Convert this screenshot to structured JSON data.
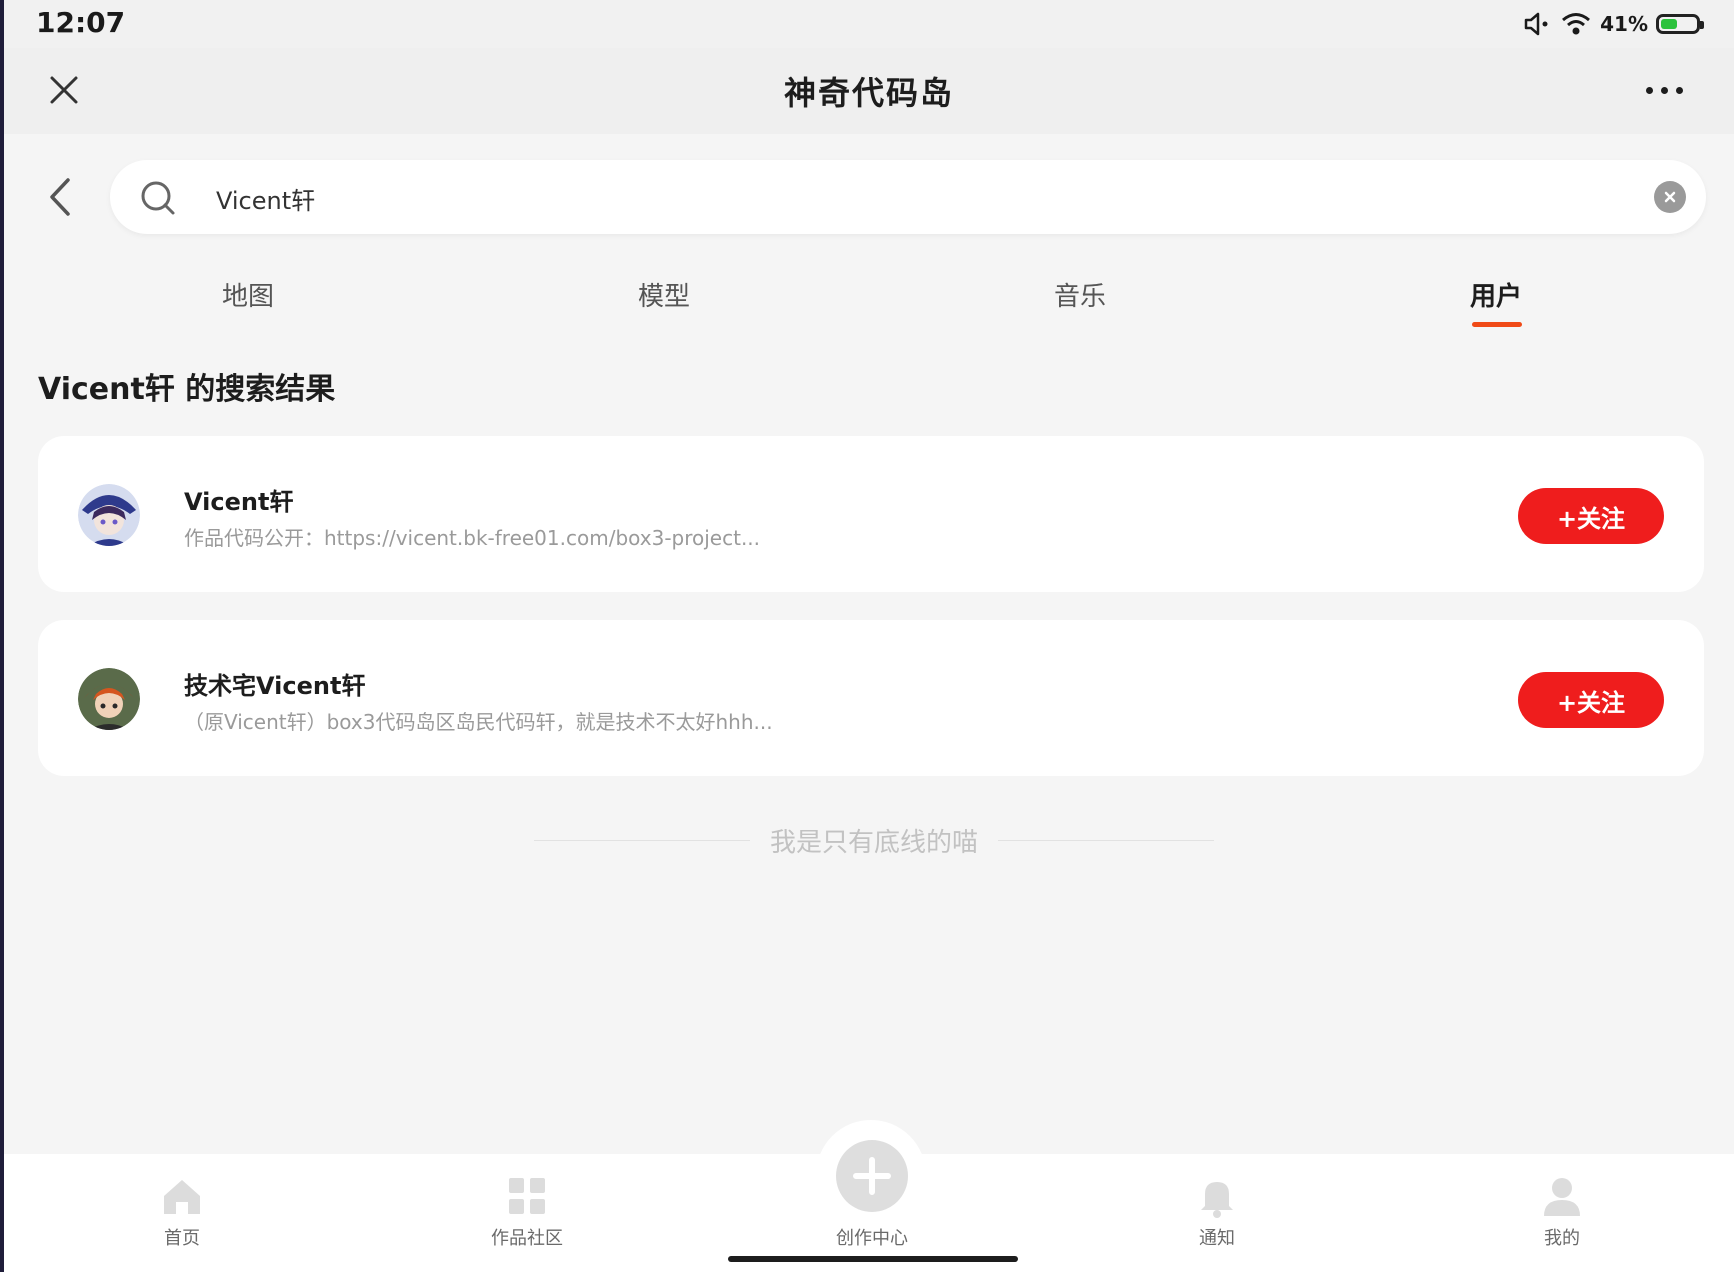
{
  "status_bar": {
    "time": "12:07",
    "battery_text": "41%",
    "battery_level": 0.41,
    "icons": [
      "volume-icon",
      "wifi-icon",
      "battery-icon"
    ]
  },
  "title_bar": {
    "title": "神奇代码岛",
    "close_icon": "close-icon",
    "more_icon": "more-icon"
  },
  "search": {
    "value": "Vicent轩",
    "back_icon": "chevron-left-icon",
    "search_icon": "search-icon",
    "clear_icon": "clear-icon"
  },
  "tabs": [
    {
      "label": "地图",
      "active": false
    },
    {
      "label": "模型",
      "active": false
    },
    {
      "label": "音乐",
      "active": false
    },
    {
      "label": "用户",
      "active": true
    }
  ],
  "results": {
    "heading": "Vicent轩 的搜索结果",
    "users": [
      {
        "name": "Vicent轩",
        "description": "作品代码公开：https://vicent.bk-free01.com/box3-project...",
        "follow_label": "+关注"
      },
      {
        "name": "技术宅Vicent轩",
        "description": "（原Vicent轩）box3代码岛区岛民代码轩，就是技术不太好hhh...",
        "follow_label": "+关注"
      }
    ],
    "end_text": "我是只有底线的喵"
  },
  "bottom_nav": {
    "items": [
      {
        "label": "首页",
        "icon": "home-icon"
      },
      {
        "label": "作品社区",
        "icon": "grid-icon"
      },
      {
        "label": "创作中心",
        "icon": "plus-circle-icon"
      },
      {
        "label": "通知",
        "icon": "bell-icon"
      },
      {
        "label": "我的",
        "icon": "user-icon"
      }
    ]
  },
  "colors": {
    "accent": "#ef1d1d",
    "tab_indicator": "#f04a17",
    "battery": "#2bc23c"
  }
}
